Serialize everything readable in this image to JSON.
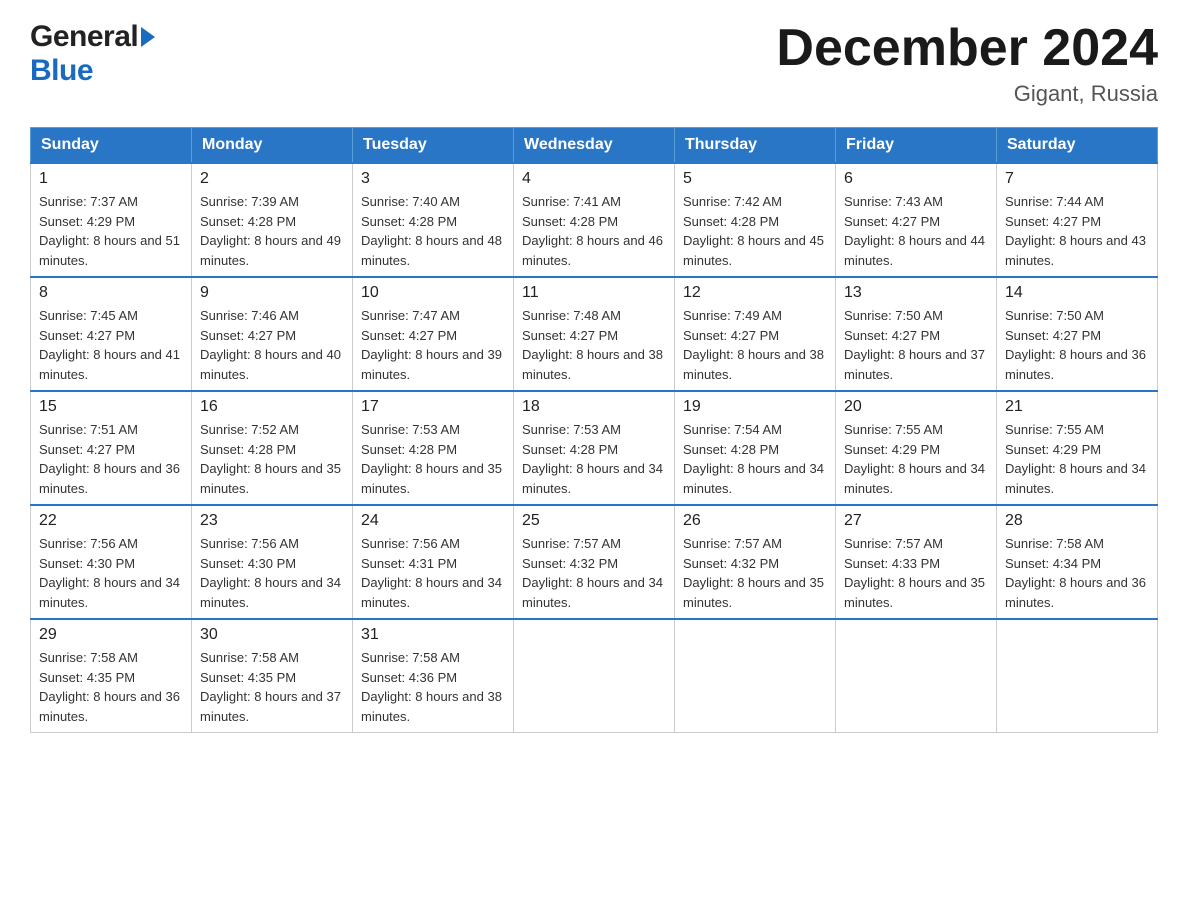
{
  "header": {
    "logo_general": "General",
    "logo_blue": "Blue",
    "month_title": "December 2024",
    "location": "Gigant, Russia"
  },
  "weekdays": [
    "Sunday",
    "Monday",
    "Tuesday",
    "Wednesday",
    "Thursday",
    "Friday",
    "Saturday"
  ],
  "weeks": [
    [
      {
        "day": "1",
        "sunrise": "7:37 AM",
        "sunset": "4:29 PM",
        "daylight": "8 hours and 51 minutes."
      },
      {
        "day": "2",
        "sunrise": "7:39 AM",
        "sunset": "4:28 PM",
        "daylight": "8 hours and 49 minutes."
      },
      {
        "day": "3",
        "sunrise": "7:40 AM",
        "sunset": "4:28 PM",
        "daylight": "8 hours and 48 minutes."
      },
      {
        "day": "4",
        "sunrise": "7:41 AM",
        "sunset": "4:28 PM",
        "daylight": "8 hours and 46 minutes."
      },
      {
        "day": "5",
        "sunrise": "7:42 AM",
        "sunset": "4:28 PM",
        "daylight": "8 hours and 45 minutes."
      },
      {
        "day": "6",
        "sunrise": "7:43 AM",
        "sunset": "4:27 PM",
        "daylight": "8 hours and 44 minutes."
      },
      {
        "day": "7",
        "sunrise": "7:44 AM",
        "sunset": "4:27 PM",
        "daylight": "8 hours and 43 minutes."
      }
    ],
    [
      {
        "day": "8",
        "sunrise": "7:45 AM",
        "sunset": "4:27 PM",
        "daylight": "8 hours and 41 minutes."
      },
      {
        "day": "9",
        "sunrise": "7:46 AM",
        "sunset": "4:27 PM",
        "daylight": "8 hours and 40 minutes."
      },
      {
        "day": "10",
        "sunrise": "7:47 AM",
        "sunset": "4:27 PM",
        "daylight": "8 hours and 39 minutes."
      },
      {
        "day": "11",
        "sunrise": "7:48 AM",
        "sunset": "4:27 PM",
        "daylight": "8 hours and 38 minutes."
      },
      {
        "day": "12",
        "sunrise": "7:49 AM",
        "sunset": "4:27 PM",
        "daylight": "8 hours and 38 minutes."
      },
      {
        "day": "13",
        "sunrise": "7:50 AM",
        "sunset": "4:27 PM",
        "daylight": "8 hours and 37 minutes."
      },
      {
        "day": "14",
        "sunrise": "7:50 AM",
        "sunset": "4:27 PM",
        "daylight": "8 hours and 36 minutes."
      }
    ],
    [
      {
        "day": "15",
        "sunrise": "7:51 AM",
        "sunset": "4:27 PM",
        "daylight": "8 hours and 36 minutes."
      },
      {
        "day": "16",
        "sunrise": "7:52 AM",
        "sunset": "4:28 PM",
        "daylight": "8 hours and 35 minutes."
      },
      {
        "day": "17",
        "sunrise": "7:53 AM",
        "sunset": "4:28 PM",
        "daylight": "8 hours and 35 minutes."
      },
      {
        "day": "18",
        "sunrise": "7:53 AM",
        "sunset": "4:28 PM",
        "daylight": "8 hours and 34 minutes."
      },
      {
        "day": "19",
        "sunrise": "7:54 AM",
        "sunset": "4:28 PM",
        "daylight": "8 hours and 34 minutes."
      },
      {
        "day": "20",
        "sunrise": "7:55 AM",
        "sunset": "4:29 PM",
        "daylight": "8 hours and 34 minutes."
      },
      {
        "day": "21",
        "sunrise": "7:55 AM",
        "sunset": "4:29 PM",
        "daylight": "8 hours and 34 minutes."
      }
    ],
    [
      {
        "day": "22",
        "sunrise": "7:56 AM",
        "sunset": "4:30 PM",
        "daylight": "8 hours and 34 minutes."
      },
      {
        "day": "23",
        "sunrise": "7:56 AM",
        "sunset": "4:30 PM",
        "daylight": "8 hours and 34 minutes."
      },
      {
        "day": "24",
        "sunrise": "7:56 AM",
        "sunset": "4:31 PM",
        "daylight": "8 hours and 34 minutes."
      },
      {
        "day": "25",
        "sunrise": "7:57 AM",
        "sunset": "4:32 PM",
        "daylight": "8 hours and 34 minutes."
      },
      {
        "day": "26",
        "sunrise": "7:57 AM",
        "sunset": "4:32 PM",
        "daylight": "8 hours and 35 minutes."
      },
      {
        "day": "27",
        "sunrise": "7:57 AM",
        "sunset": "4:33 PM",
        "daylight": "8 hours and 35 minutes."
      },
      {
        "day": "28",
        "sunrise": "7:58 AM",
        "sunset": "4:34 PM",
        "daylight": "8 hours and 36 minutes."
      }
    ],
    [
      {
        "day": "29",
        "sunrise": "7:58 AM",
        "sunset": "4:35 PM",
        "daylight": "8 hours and 36 minutes."
      },
      {
        "day": "30",
        "sunrise": "7:58 AM",
        "sunset": "4:35 PM",
        "daylight": "8 hours and 37 minutes."
      },
      {
        "day": "31",
        "sunrise": "7:58 AM",
        "sunset": "4:36 PM",
        "daylight": "8 hours and 38 minutes."
      },
      null,
      null,
      null,
      null
    ]
  ],
  "labels": {
    "sunrise": "Sunrise:",
    "sunset": "Sunset:",
    "daylight": "Daylight:"
  }
}
